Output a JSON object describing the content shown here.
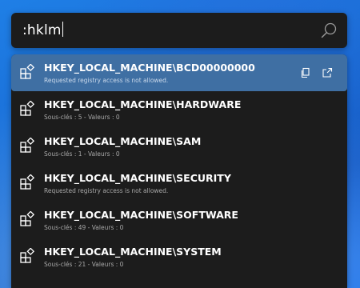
{
  "search": {
    "query": ":hklm",
    "icon": "search-icon"
  },
  "results": [
    {
      "title": "HKEY_LOCAL_MACHINE\\BCD00000000",
      "subtitle": "Requested registry access is not allowed.",
      "selected": true,
      "icon": "registry-key-icon"
    },
    {
      "title": "HKEY_LOCAL_MACHINE\\HARDWARE",
      "subtitle": "Sous-clés : 5 - Valeurs : 0",
      "selected": false,
      "icon": "registry-key-icon"
    },
    {
      "title": "HKEY_LOCAL_MACHINE\\SAM",
      "subtitle": "Sous-clés : 1 - Valeurs : 0",
      "selected": false,
      "icon": "registry-key-icon"
    },
    {
      "title": "HKEY_LOCAL_MACHINE\\SECURITY",
      "subtitle": "Requested registry access is not allowed.",
      "selected": false,
      "icon": "registry-key-icon"
    },
    {
      "title": "HKEY_LOCAL_MACHINE\\SOFTWARE",
      "subtitle": "Sous-clés : 49 - Valeurs : 0",
      "selected": false,
      "icon": "registry-key-icon"
    },
    {
      "title": "HKEY_LOCAL_MACHINE\\SYSTEM",
      "subtitle": "Sous-clés : 21 - Valeurs : 0",
      "selected": false,
      "icon": "registry-key-icon"
    }
  ],
  "actions": {
    "copy_icon": "copy-icon",
    "open_icon": "open-external-icon"
  },
  "colors": {
    "panel": "#1c1c1c",
    "selected_row": "#3f6fa3",
    "title_text": "#ffffff",
    "subtitle_text": "#a8a8a8",
    "wallpaper": "#1a6fd8"
  }
}
